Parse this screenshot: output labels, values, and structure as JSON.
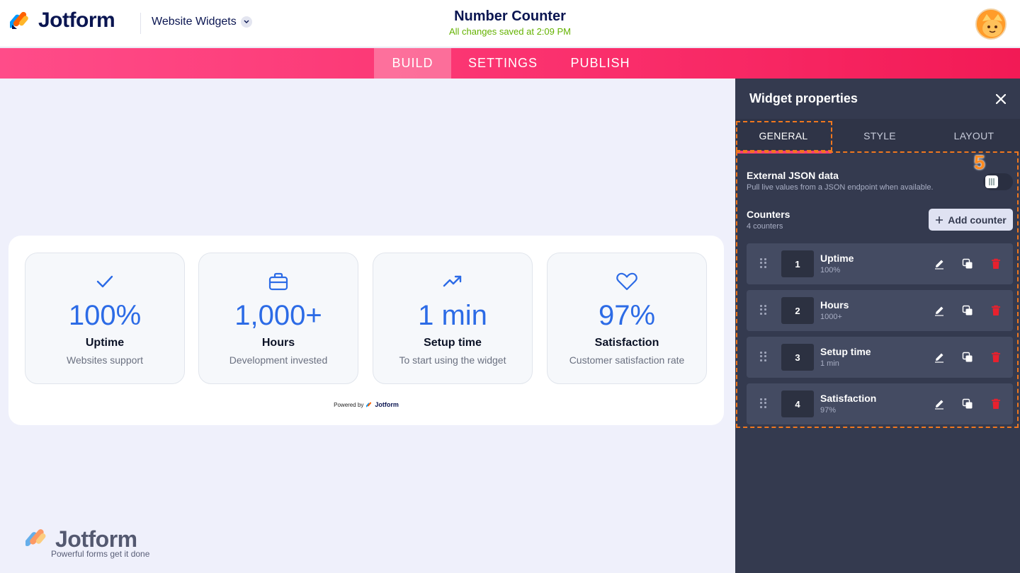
{
  "header": {
    "brand": "Jotform",
    "workspace": "Website Widgets",
    "title": "Number Counter",
    "status": "All changes saved at 2:09 PM"
  },
  "nav": {
    "tabs": [
      "BUILD",
      "SETTINGS",
      "PUBLISH"
    ],
    "active": "BUILD"
  },
  "widget": {
    "counters": [
      {
        "icon": "check-icon",
        "value": "100%",
        "label": "Uptime",
        "desc": "Websites support"
      },
      {
        "icon": "briefcase-icon",
        "value": "1,000+",
        "label": "Hours",
        "desc": "Development invested"
      },
      {
        "icon": "trending-up-icon",
        "value": "1 min",
        "label": "Setup time",
        "desc": "To start using the widget"
      },
      {
        "icon": "heart-icon",
        "value": "97%",
        "label": "Satisfaction",
        "desc": "Customer satisfaction rate"
      }
    ],
    "powered_prefix": "Powered by",
    "powered_brand": "Jotform"
  },
  "watermark": {
    "brand": "Jotform",
    "tagline": "Powerful forms get it done"
  },
  "panel": {
    "title": "Widget properties",
    "tabs": [
      "GENERAL",
      "STYLE",
      "LAYOUT"
    ],
    "active_tab": "GENERAL",
    "step_marker": "5",
    "external": {
      "title": "External JSON data",
      "subtitle": "Pull live values from a JSON endpoint when available."
    },
    "counters": {
      "title": "Counters",
      "count_text": "4 counters",
      "add_label": "Add counter",
      "items": [
        {
          "index": "1",
          "name": "Uptime",
          "value": "100%"
        },
        {
          "index": "2",
          "name": "Hours",
          "value": "1000+"
        },
        {
          "index": "3",
          "name": "Setup time",
          "value": "1 min"
        },
        {
          "index": "4",
          "name": "Satisfaction",
          "value": "97%"
        }
      ]
    }
  },
  "colors": {
    "accent_blue": "#2c6be6",
    "nav_pink": "#fa2e6b",
    "panel_bg": "#343a4f",
    "annotation_orange": "#f0771e",
    "delete_red": "#e8212e"
  }
}
